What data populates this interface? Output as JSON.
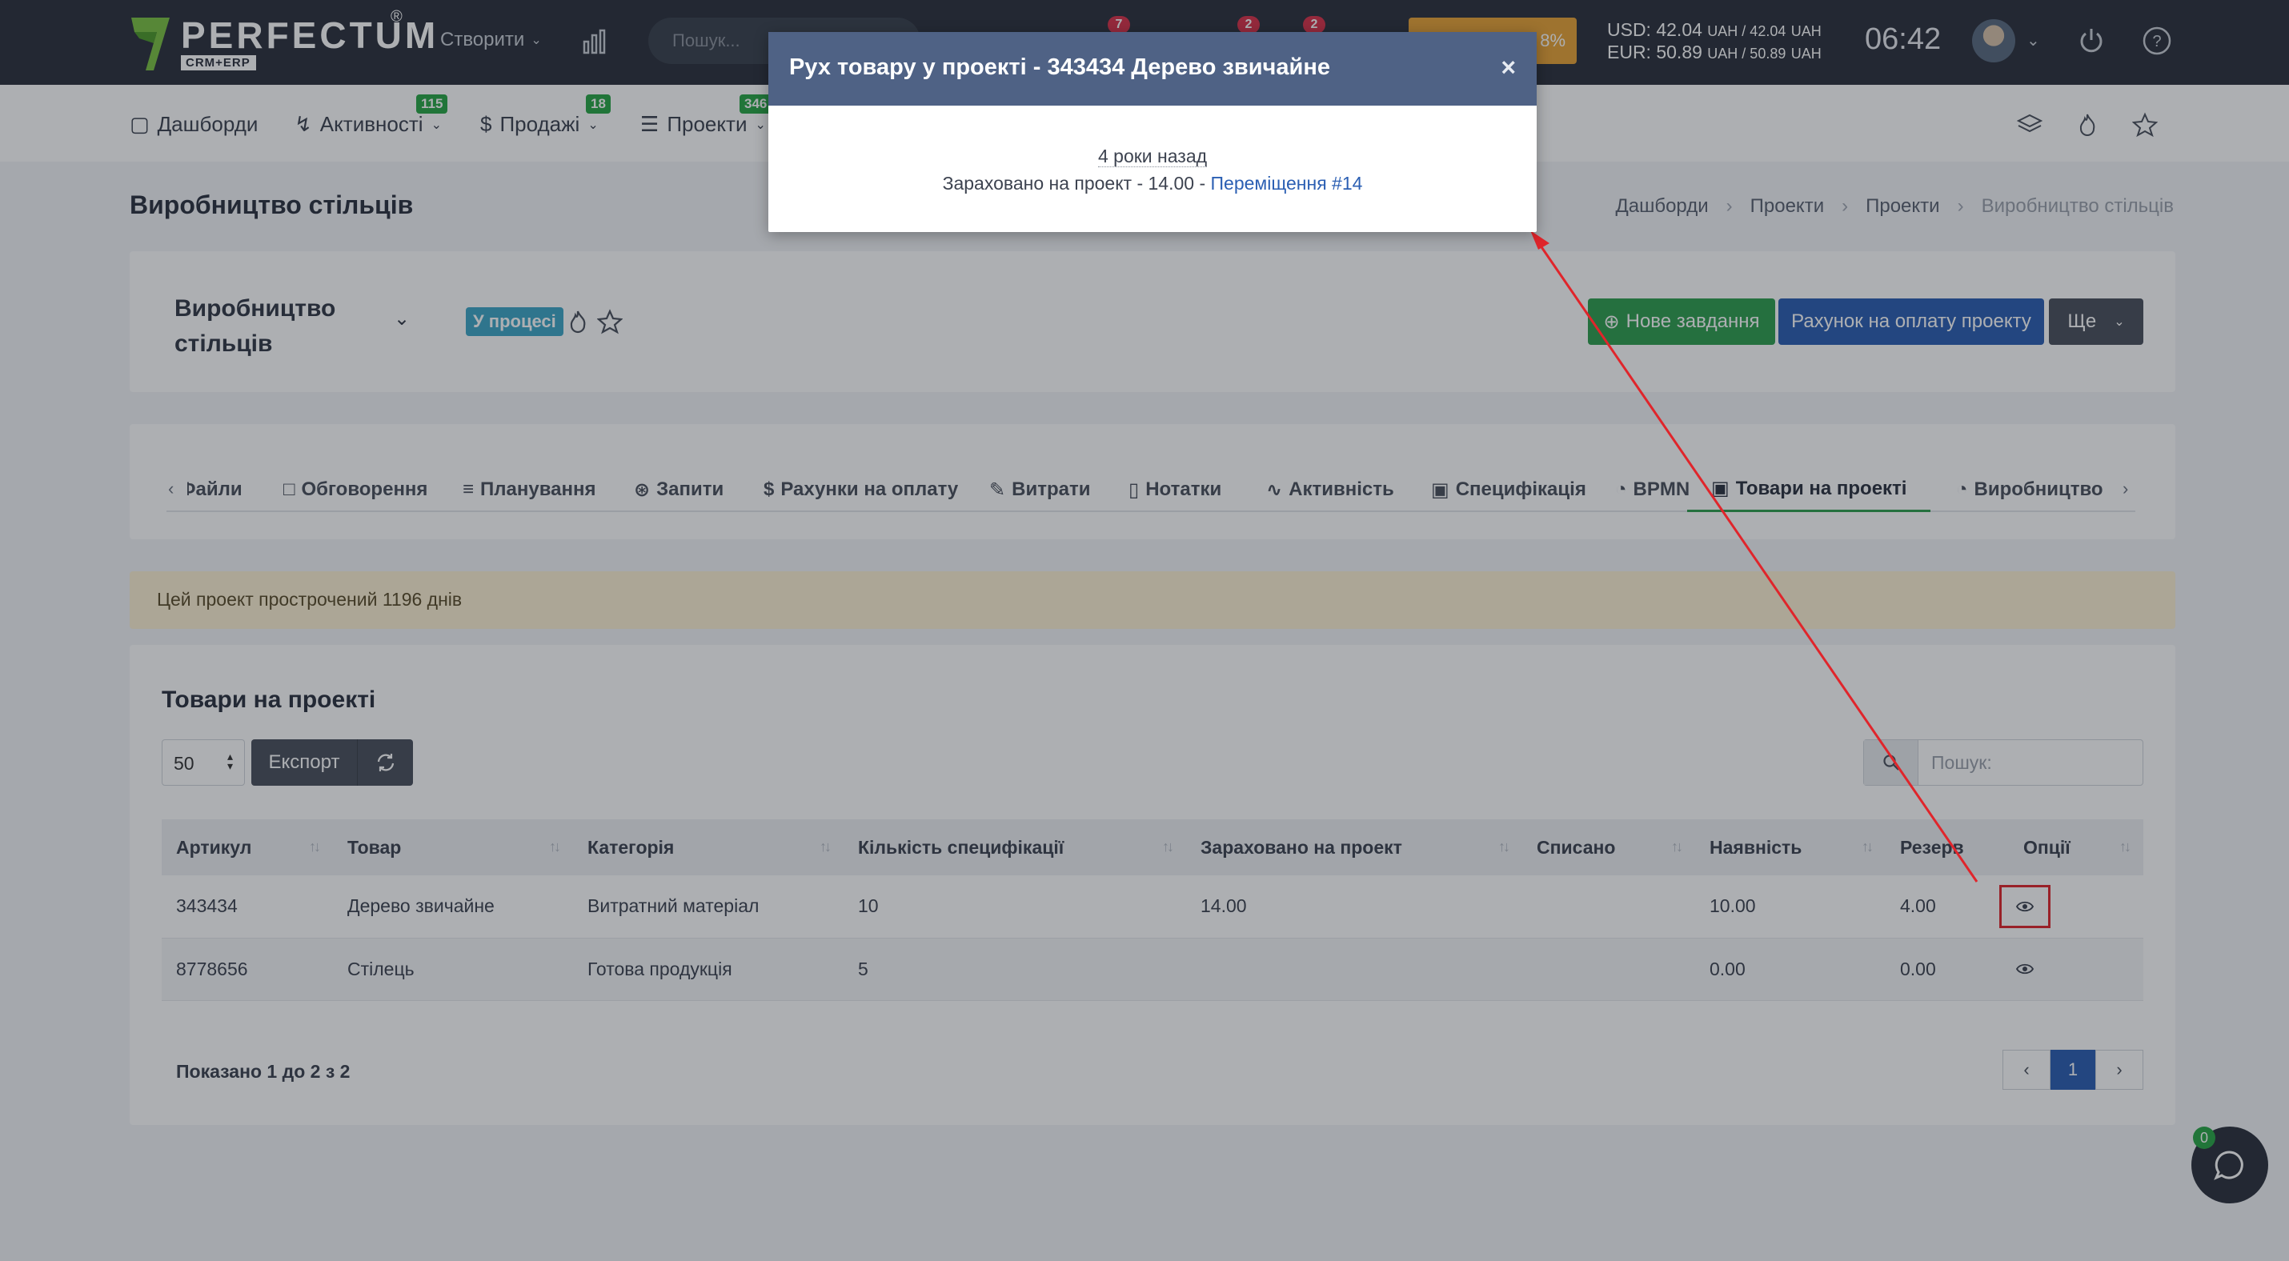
{
  "header": {
    "logo_name": "PERFECTUM",
    "logo_sub": "CRM+ERP",
    "logo_reg": "®",
    "create_label": "Створити",
    "search_placeholder": "Пошук...",
    "badges": [
      "7",
      "2",
      "2"
    ],
    "promo_text": "8%",
    "rates": {
      "usd_label": "USD: 42.04",
      "usd_mid": "UAH / 42.04",
      "eur_label": "EUR: 50.89",
      "eur_mid": "UAH / 50.89",
      "currency": "UAH"
    },
    "clock": "06:42"
  },
  "nav": {
    "items": [
      {
        "label": "Дашборди",
        "icon": "monitor-icon"
      },
      {
        "label": "Активності",
        "icon": "bolt-icon",
        "badge": "115"
      },
      {
        "label": "Продажі",
        "icon": "dollar-icon",
        "badge": "18"
      },
      {
        "label": "Проекти",
        "icon": "layers-icon",
        "badge": "346"
      }
    ]
  },
  "page": {
    "title": "Виробництво стільців",
    "breadcrumb": [
      "Дашборди",
      "Проекти",
      "Проекти",
      "Виробництво стільців"
    ]
  },
  "project": {
    "name": "Виробництво стільців",
    "status": "У процесі",
    "new_task": "Нове завдання",
    "invoice": "Рахунок на оплату проекту",
    "more": "Ще"
  },
  "tabs": [
    {
      "label": "Файли",
      "icon": "file-icon"
    },
    {
      "label": "Обговорення",
      "icon": "chat-icon"
    },
    {
      "label": "Планування",
      "icon": "list-icon"
    },
    {
      "label": "Запити",
      "icon": "lifebuoy-icon"
    },
    {
      "label": "Рахунки на оплату",
      "icon": "dollar-icon"
    },
    {
      "label": "Витрати",
      "icon": "edit-icon"
    },
    {
      "label": "Нотатки",
      "icon": "book-icon"
    },
    {
      "label": "Активність",
      "icon": "activity-icon"
    },
    {
      "label": "Специфікація",
      "icon": "box-icon"
    },
    {
      "label": "BPMN",
      "icon": "pie-icon"
    },
    {
      "label": "Товари на проекті",
      "icon": "box-icon",
      "active": true
    },
    {
      "label": "Виробництво",
      "icon": "pie-icon"
    }
  ],
  "alert": "Цей проект прострочений 1196 днів",
  "products": {
    "title": "Товари на проекті",
    "page_length": "50",
    "export_label": "Експорт",
    "search_placeholder": "Пошук:",
    "columns": [
      "Артикул",
      "Товар",
      "Категорія",
      "Кількість специфікації",
      "Зараховано на проект",
      "Списано",
      "Наявність",
      "Резерв",
      "Опції"
    ],
    "rows": [
      {
        "sku": "343434",
        "name": "Дерево звичайне",
        "category": "Витратний матеріал",
        "spec_qty": "10",
        "credited": "14.00",
        "written_off": "",
        "stock": "10.00",
        "reserve": "4.00"
      },
      {
        "sku": "8778656",
        "name": "Стілець",
        "category": "Готова продукція",
        "spec_qty": "5",
        "credited": "",
        "written_off": "",
        "stock": "0.00",
        "reserve": "0.00"
      }
    ],
    "shown_text": "Показано 1 до 2 з 2",
    "page_current": "1"
  },
  "modal": {
    "title": "Рух товару у проекті - 343434 Дерево звичайне",
    "time": "4 роки назад",
    "line_prefix": "Зараховано на проект - 14.00 - ",
    "link": "Переміщення #14"
  },
  "chat": {
    "badge": "0"
  },
  "colors": {
    "topbar": "#2b313c",
    "accent_green": "#2f9e4f",
    "accent_blue": "#2b5fb3",
    "modal_header": "#4f6285",
    "annotation_red": "#e0252b"
  }
}
